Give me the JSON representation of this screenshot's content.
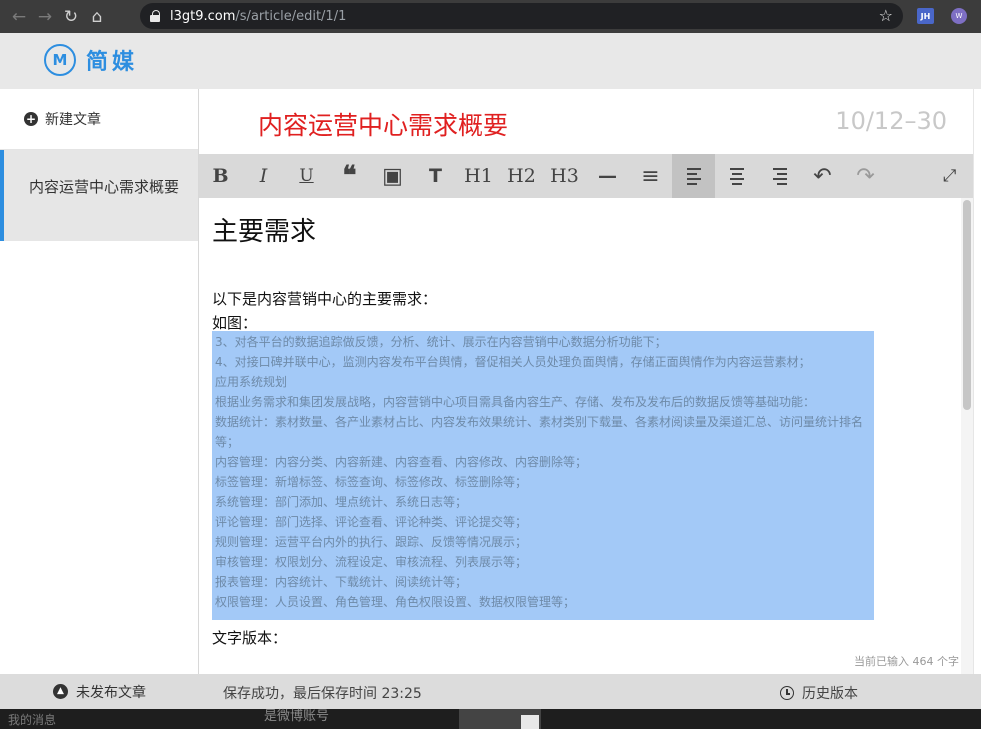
{
  "browser": {
    "url_domain": "l3gt9.com",
    "url_path": "/s/article/edit/1/1",
    "ext_jh": "JH",
    "ext_w": "W"
  },
  "app": {
    "logo_mark": "M",
    "logo_text": "简媒"
  },
  "sidebar": {
    "new_article": "新建文章",
    "article_item": "内容运营中心需求概要",
    "footer": "未发布文章"
  },
  "editor": {
    "title": "内容运营中心需求概要",
    "word_range": "10/12–30",
    "toolbar": [
      "B",
      "I",
      "U",
      "❝",
      "▣",
      "T",
      "H1",
      "H2",
      "H3",
      "—",
      "≡",
      "≡",
      "≡",
      "≡",
      "↶",
      "↷",
      "⤢"
    ],
    "heading": "主要需求",
    "intro": "以下是内容营销中心的主要需求：",
    "figure_label": "如图：",
    "image_lines": [
      "3、对各平台的数据追踪做反馈，分析、统计、展示在内容营销中心数据分析功能下；",
      "4、对接口碑并联中心，监测内容发布平台舆情，督促相关人员处理负面舆情，存储正面舆情作为内容运营素材；",
      "应用系统规划",
      "根据业务需求和集团发展战略，内容营销中心项目需具备内容生产、存储、发布及发布后的数据反馈等基础功能：",
      "数据统计：素材数量、各产业素材占比、内容发布效果统计、素材类别下载量、各素材阅读量及渠道汇总、访问量统计排名等；",
      "内容管理：内容分类、内容新建、内容查看、内容修改、内容删除等；",
      "标签管理：新增标签、标签查询、标签修改、标签删除等；",
      "系统管理：部门添加、埋点统计、系统日志等；",
      "评论管理：部门选择、评论查看、评论种类、评论提交等；",
      "规则管理：运营平台内外的执行、跟踪、反馈等情况展示；",
      "审核管理：权限划分、流程设定、审核流程、列表展示等；",
      "报表管理：内容统计、下载统计、阅读统计等；",
      "权限管理：人员设置、角色管理、角色权限设置、数据权限管理等；"
    ],
    "text_version": "文字版本：",
    "char_count": "当前已输入 464 个字"
  },
  "footer": {
    "save_status": "保存成功，最后保存时间 23:25",
    "history": "历史版本"
  },
  "bleed": {
    "messages": "我的消息",
    "follow": "是微博账号"
  }
}
